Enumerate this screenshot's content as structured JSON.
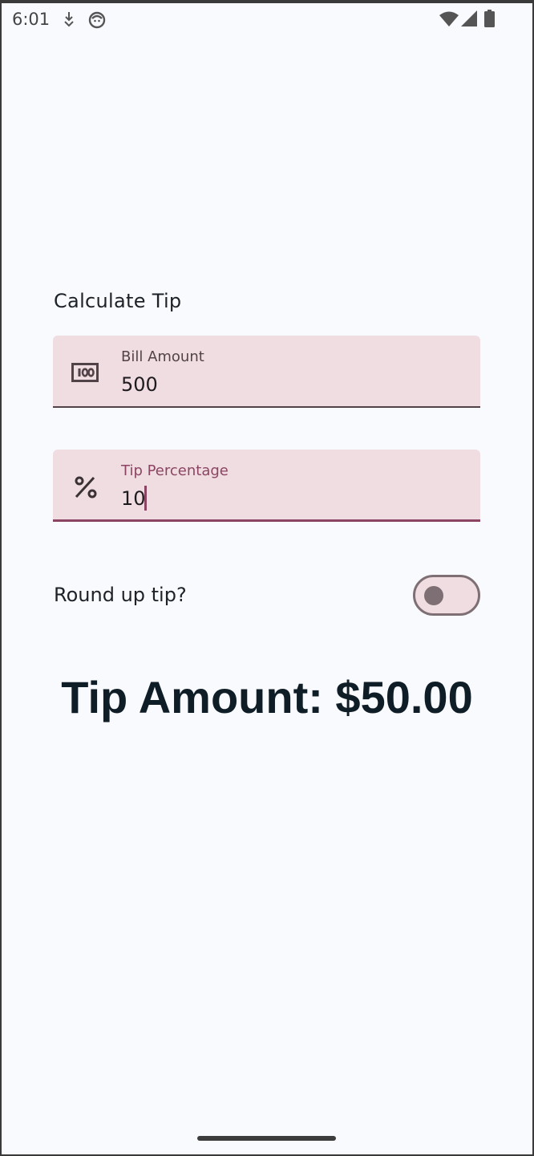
{
  "status_bar": {
    "time": "6:01",
    "left_icons": [
      "download-status-icon",
      "app-notification-icon"
    ],
    "right_icons": [
      "wifi-icon",
      "cellular-signal-icon",
      "battery-icon"
    ]
  },
  "app": {
    "title": "Calculate Tip",
    "bill_field": {
      "label": "Bill Amount",
      "value": "500",
      "icon": "money-icon"
    },
    "tip_field": {
      "label": "Tip Percentage",
      "value": "10",
      "icon": "percent-icon",
      "focused": true
    },
    "round_up": {
      "label": "Round up tip?",
      "checked": false
    },
    "result": "Tip Amount: $50.00"
  },
  "colors": {
    "background": "#f9fafe",
    "field_fill": "#f0dde1",
    "accent": "#8b4562",
    "text_dark": "#0f1d27"
  }
}
